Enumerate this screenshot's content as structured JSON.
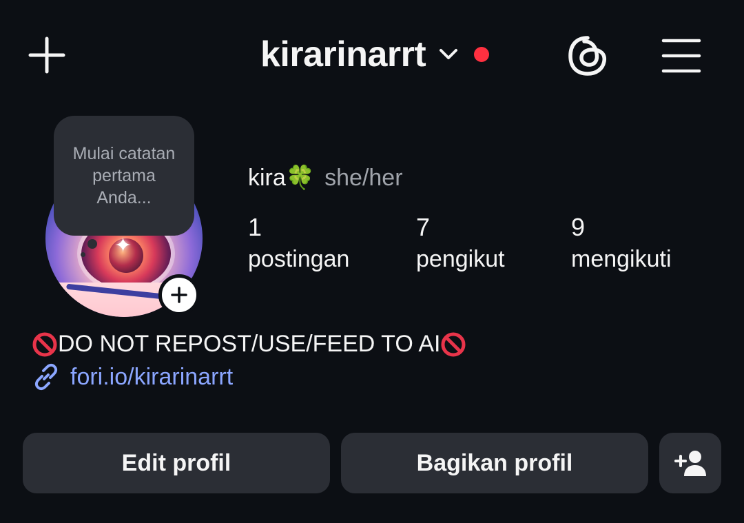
{
  "header": {
    "create_icon": "plus-icon",
    "username": "kirarinarrt",
    "dropdown_icon": "chevron-down-icon",
    "notification_dot_color": "#ff3040",
    "threads_icon": "threads-icon",
    "menu_icon": "hamburger-menu-icon"
  },
  "profile": {
    "note_text": "Mulai catatan pertama Anda...",
    "add_story_icon": "plus-icon",
    "display_name": "kira🍀",
    "pronouns": "she/her",
    "stats": [
      {
        "value": "1",
        "label": "postingan"
      },
      {
        "value": "7",
        "label": "pengikut"
      },
      {
        "value": "9",
        "label": "mengikuti"
      }
    ],
    "bio": "DO NOT REPOST/USE/FEED TO AI",
    "bio_icon": "prohibited-icon",
    "link_icon": "link-icon",
    "link": "fori.io/kirarinarrt"
  },
  "actions": {
    "edit_label": "Edit profil",
    "share_label": "Bagikan profil",
    "suggest_icon": "add-person-icon"
  },
  "colors": {
    "background": "#0c0f14",
    "button_bg": "#2b2e35",
    "link": "#8ba6ff",
    "muted_text": "#a0a4ab"
  }
}
